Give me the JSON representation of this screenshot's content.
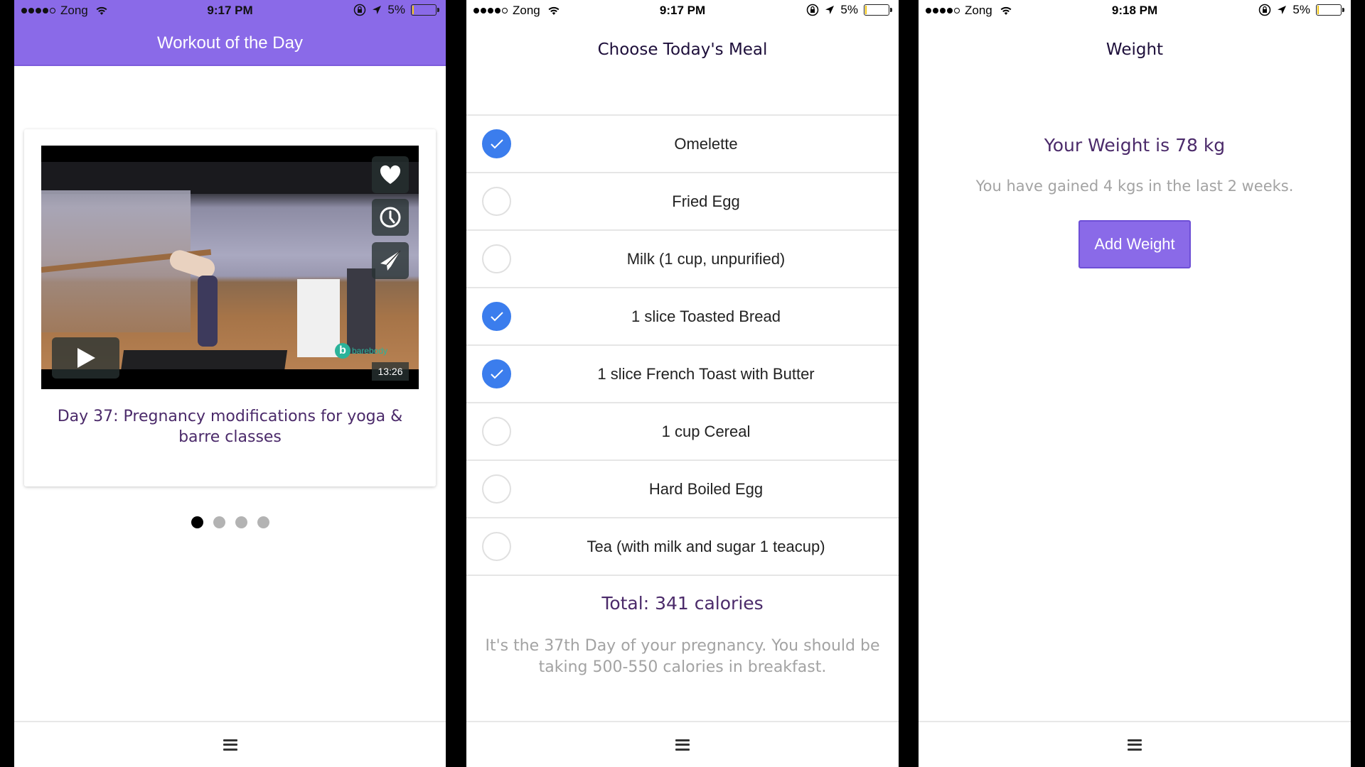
{
  "screens": [
    {
      "status": {
        "carrier": "Zong",
        "time": "9:17 PM",
        "battery": "5%",
        "battery_level": 0.05
      },
      "header": {
        "title": "Workout of the Day"
      },
      "card": {
        "video": {
          "duration": "13:26",
          "brand_letter": "b",
          "brand_text": "barebody"
        },
        "caption": "Day 37: Pregnancy modifications for yoga & barre classes"
      },
      "pager": {
        "count": 4,
        "active_index": 0
      }
    },
    {
      "status": {
        "carrier": "Zong",
        "time": "9:17 PM",
        "battery": "5%",
        "battery_level": 0.05
      },
      "header": {
        "title": "Choose Today's Meal"
      },
      "meals": [
        {
          "label": "Omelette",
          "checked": true
        },
        {
          "label": "Fried Egg",
          "checked": false
        },
        {
          "label": "Milk (1 cup, unpurified)",
          "checked": false
        },
        {
          "label": "1 slice Toasted Bread",
          "checked": true
        },
        {
          "label": "1 slice French Toast with Butter",
          "checked": true
        },
        {
          "label": "1 cup Cereal",
          "checked": false
        },
        {
          "label": "Hard Boiled Egg",
          "checked": false
        },
        {
          "label": "Tea (with milk and sugar 1 teacup)",
          "checked": false
        }
      ],
      "total": "Total: 341 calories",
      "hint": "It's the 37th Day of your pregnancy. You should be taking 500-550 calories in breakfast."
    },
    {
      "status": {
        "carrier": "Zong",
        "time": "9:18 PM",
        "battery": "5%",
        "battery_level": 0.05
      },
      "header": {
        "title": "Weight"
      },
      "weight_title": "Your Weight is 78 kg",
      "weight_subtitle": "You have gained 4 kgs in the last 2 weeks.",
      "add_button": "Add Weight"
    }
  ],
  "colors": {
    "accent_purple": "#8a6ae8",
    "text_purple": "#4b2a6a",
    "check_blue": "#3b7ded",
    "hint_gray": "#a3a3a3"
  },
  "icons": {
    "signal": "signal-dots-icon",
    "wifi": "wifi-icon",
    "orientation_lock": "orientation-lock-icon",
    "location": "location-arrow-icon",
    "battery": "battery-icon",
    "heart": "heart-icon",
    "clock": "clock-icon",
    "share": "paper-plane-icon",
    "play": "play-icon",
    "menu": "hamburger-menu-icon"
  }
}
